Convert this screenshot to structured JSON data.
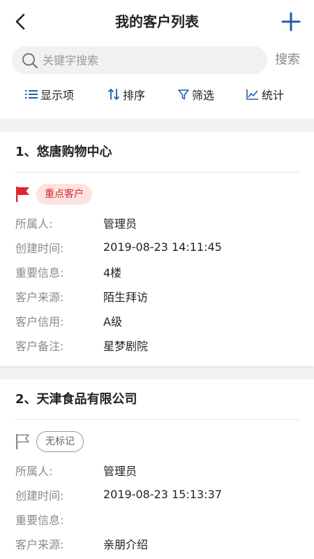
{
  "nav": {
    "title": "我的客户列表"
  },
  "search": {
    "placeholder": "关键字搜索",
    "button_label": "搜索"
  },
  "toolbar": {
    "display": "显示项",
    "sort": "排序",
    "filter": "筛选",
    "stats": "统计"
  },
  "colors": {
    "accent": "#1f5fa8",
    "key_tag": "#d9272d",
    "key_tag_bg": "#fde2e2"
  },
  "customers": [
    {
      "title": "1、悠唐购物中心",
      "tag": "重点客户",
      "tag_type": "key",
      "fields": [
        {
          "label": "所属人:",
          "value": "管理员"
        },
        {
          "label": "创建时间:",
          "value": "2019-08-23 14:11:45"
        },
        {
          "label": "重要信息:",
          "value": "4楼"
        },
        {
          "label": "客户来源:",
          "value": "陌生拜访"
        },
        {
          "label": "客户信用:",
          "value": "A级"
        },
        {
          "label": "客户备注:",
          "value": "星梦剧院"
        }
      ]
    },
    {
      "title": "2、天津食品有限公司",
      "tag": "无标记",
      "tag_type": "none",
      "fields": [
        {
          "label": "所属人:",
          "value": "管理员"
        },
        {
          "label": "创建时间:",
          "value": "2019-08-23 15:13:37"
        },
        {
          "label": "重要信息:",
          "value": ""
        },
        {
          "label": "客户来源:",
          "value": "亲朋介绍"
        }
      ]
    }
  ]
}
